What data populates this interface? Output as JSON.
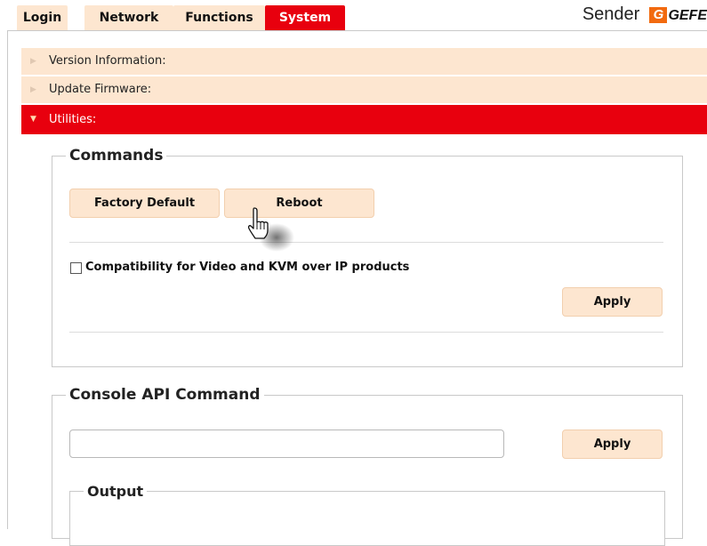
{
  "tabs": [
    {
      "label": "Login",
      "active": false
    },
    {
      "label": "Network",
      "active": false
    },
    {
      "label": "Functions",
      "active": false
    },
    {
      "label": "System",
      "active": true
    }
  ],
  "brand": {
    "label": "Sender",
    "logo_text": "GEFE"
  },
  "panels": {
    "version": "Version Information:",
    "firmware": "Update Firmware:",
    "utilities": "Utilities:"
  },
  "commands": {
    "legend": "Commands",
    "factory_default_label": "Factory Default",
    "reboot_label": "Reboot",
    "compat_label": "Compatibility for Video and KVM over IP products",
    "compat_checked": false,
    "apply_label": "Apply"
  },
  "console": {
    "legend": "Console API Command",
    "input_value": "",
    "apply_label": "Apply",
    "output_legend": "Output"
  },
  "colors": {
    "accent": "#e8000e",
    "panel_bg": "#fde6d0",
    "logo_orange": "#f26a0f"
  },
  "icons": {
    "cursor": "hand-pointer-icon"
  }
}
